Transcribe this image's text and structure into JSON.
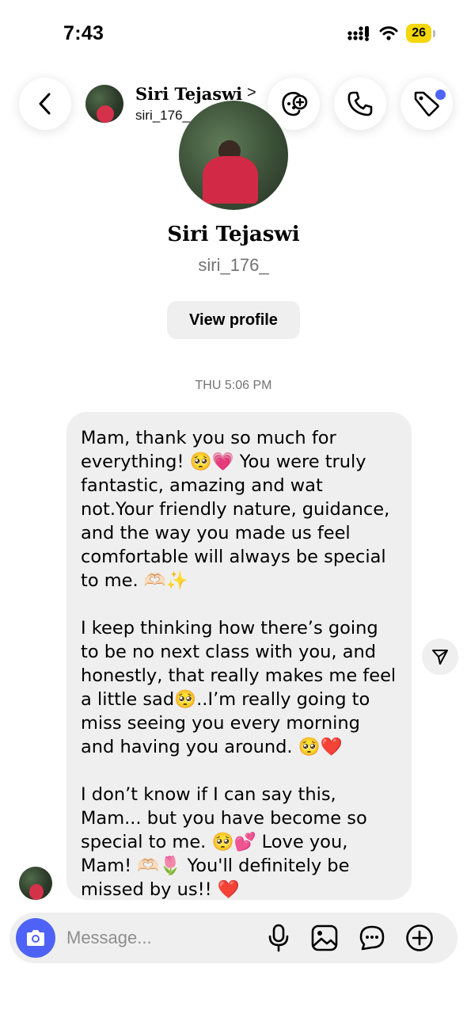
{
  "status_bar": {
    "time": "7:43",
    "battery": "26"
  },
  "header": {
    "name": "Siri Tejaswi",
    "chevron": ">",
    "handle": "siri_176_",
    "icons": [
      "back-icon",
      "video-effects-icon",
      "phone-icon",
      "tag-icon"
    ],
    "tag_dot_color": "#4e63f5"
  },
  "profile": {
    "name": "Siri Tejaswi",
    "handle": "siri_176_",
    "view_profile_label": "View profile"
  },
  "thread": {
    "timestamp": "THU 5:06 PM",
    "message": {
      "paragraph_1": "Mam, thank you so much for everything! 🥺💗 You were truly fantastic, amazing  and wat not.Your friendly nature, guidance, and the way you made us feel comfortable will always be special to me. 🫶🏻✨",
      "paragraph_2": "I keep thinking how there’s going to be no next class with you, and honestly, that really makes me feel a little sad🥺..I’m really going to miss seeing you every morning and having you around. 🥺❤️",
      "paragraph_3": "I don’t know if I can say this, Mam... but you have become so special to me. 🥺💕 Love you, Mam! 🫶🏻🌷 You'll definitely be missed by us!! ❤️"
    }
  },
  "composer": {
    "placeholder": "Message...",
    "accent_color": "#4e63f5",
    "icons": [
      "camera-icon",
      "microphone-icon",
      "gallery-icon",
      "sticker-chat-icon",
      "add-icon"
    ]
  }
}
